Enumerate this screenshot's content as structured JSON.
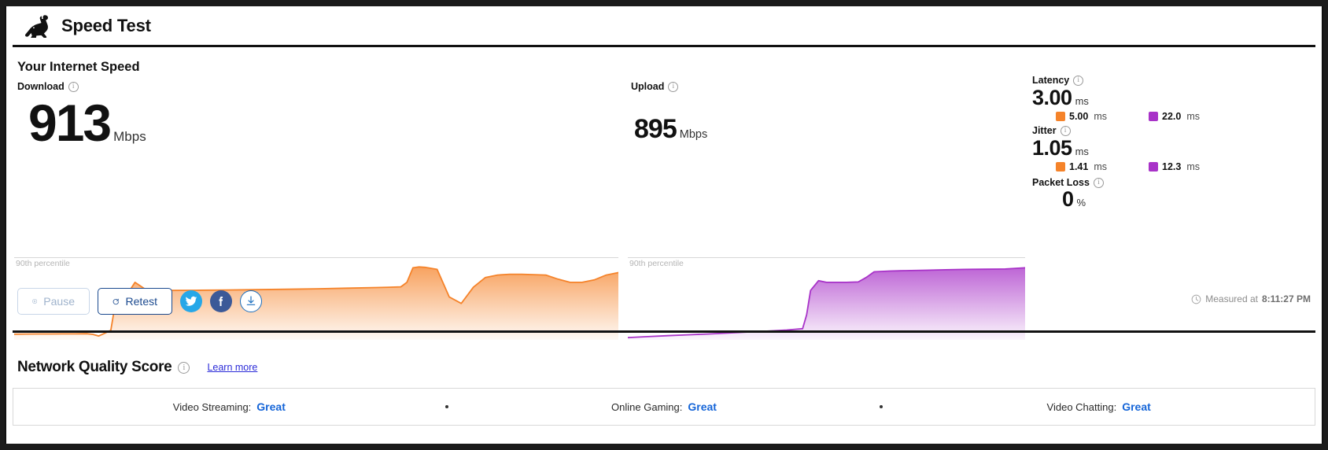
{
  "app": {
    "title": "Speed Test",
    "logo_icon": "rabbit-icon"
  },
  "section": {
    "heading": "Your Internet Speed"
  },
  "download": {
    "label": "Download",
    "info_icon": "info-icon",
    "value": "913",
    "unit": "Mbps",
    "graph_caption": "90th percentile",
    "color": "#f5832a"
  },
  "upload": {
    "label": "Upload",
    "info_icon": "info-icon",
    "value": "895",
    "unit": "Mbps",
    "graph_caption": "90th percentile",
    "color": "#a832c8"
  },
  "stats": {
    "latency": {
      "label": "Latency",
      "value": "3.00",
      "unit": "ms",
      "download": {
        "icon": "download-arrow-icon",
        "value": "5.00",
        "unit": "ms"
      },
      "upload": {
        "icon": "upload-arrow-icon",
        "value": "22.0",
        "unit": "ms"
      }
    },
    "jitter": {
      "label": "Jitter",
      "value": "1.05",
      "unit": "ms",
      "download": {
        "icon": "download-arrow-icon",
        "value": "1.41",
        "unit": "ms"
      },
      "upload": {
        "icon": "upload-arrow-icon",
        "value": "12.3",
        "unit": "ms"
      }
    },
    "packet_loss": {
      "label": "Packet Loss",
      "value": "0",
      "unit": "%"
    }
  },
  "controls": {
    "pause_label": "Pause",
    "pause_icon": "pause-icon",
    "retest_label": "Retest",
    "retest_icon": "refresh-icon",
    "twitter_icon": "twitter-icon",
    "facebook_icon": "facebook-icon",
    "download_icon": "download-icon",
    "measured_prefix": "Measured at",
    "measured_time": "8:11:27 PM",
    "clock_icon": "clock-icon"
  },
  "network_quality": {
    "title": "Network Quality Score",
    "info_icon": "info-icon",
    "learn_more": "Learn more",
    "items": [
      {
        "label": "Video Streaming:",
        "value": "Great"
      },
      {
        "label": "Online Gaming:",
        "value": "Great"
      },
      {
        "label": "Video Chatting:",
        "value": "Great"
      }
    ]
  },
  "chart_data": [
    {
      "type": "area",
      "title": "Download throughput over time",
      "ylabel": "Mbps",
      "xlabel": "",
      "annotations": [
        "90th percentile"
      ],
      "color": "#f5832a",
      "ylim": [
        0,
        1000
      ],
      "x": [
        0,
        2,
        4,
        6,
        8,
        10,
        12,
        13,
        14,
        15,
        16,
        17,
        18,
        19,
        20,
        22,
        25,
        30,
        35,
        40,
        45,
        50,
        55,
        60,
        62,
        64,
        65,
        66,
        67,
        68,
        70,
        72,
        74,
        76,
        78,
        80,
        82,
        84,
        86,
        88,
        90,
        92,
        94,
        96,
        98,
        100
      ],
      "values": [
        60,
        62,
        63,
        63,
        64,
        64,
        66,
        58,
        38,
        72,
        110,
        560,
        600,
        585,
        700,
        600,
        600,
        602,
        606,
        610,
        615,
        620,
        628,
        636,
        640,
        645,
        700,
        880,
        890,
        885,
        860,
        520,
        440,
        640,
        760,
        790,
        800,
        800,
        795,
        790,
        740,
        700,
        700,
        730,
        790,
        820
      ]
    },
    {
      "type": "area",
      "title": "Upload throughput over time",
      "ylabel": "Mbps",
      "xlabel": "",
      "annotations": [
        "90th percentile"
      ],
      "color": "#a832c8",
      "ylim": [
        0,
        1000
      ],
      "x": [
        0,
        5,
        10,
        15,
        20,
        25,
        30,
        35,
        40,
        42,
        44,
        45,
        46,
        48,
        50,
        55,
        58,
        60,
        62,
        64,
        66,
        70,
        75,
        80,
        85,
        90,
        95,
        100
      ],
      "values": [
        18,
        30,
        42,
        52,
        62,
        74,
        86,
        98,
        112,
        120,
        128,
        300,
        600,
        720,
        700,
        700,
        705,
        760,
        830,
        835,
        840,
        845,
        850,
        855,
        860,
        862,
        865,
        880
      ]
    }
  ]
}
